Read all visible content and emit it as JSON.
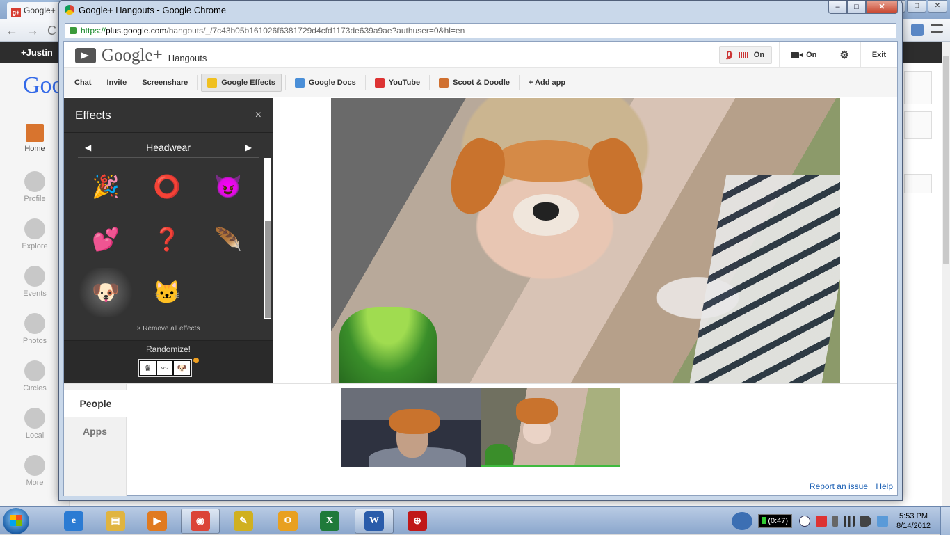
{
  "background_window": {
    "tab_label": "Google+",
    "user_name": "+Justin",
    "logo": "Goo",
    "nav_items": [
      {
        "label": "Home",
        "icon": "home-icon"
      },
      {
        "label": "Profile",
        "icon": "profile-icon"
      },
      {
        "label": "Explore",
        "icon": "compass-icon"
      },
      {
        "label": "Events",
        "icon": "calendar-icon"
      },
      {
        "label": "Photos",
        "icon": "camera-icon"
      },
      {
        "label": "Circles",
        "icon": "circles-icon"
      },
      {
        "label": "Local",
        "icon": "pin-icon"
      },
      {
        "label": "More",
        "icon": "more-icon"
      }
    ]
  },
  "popup": {
    "window_title": "Google+ Hangouts - Google Chrome",
    "url_protocol": "https://",
    "url_host": "plus.google.com",
    "url_path": "/hangouts/_/7c43b05b161026f6381729d4cfd1173de639a9ae?authuser=0&hl=en"
  },
  "hangout": {
    "brand": "Google+",
    "product": "Hangouts",
    "mic_label": "On",
    "camera_label": "On",
    "exit_label": "Exit",
    "toolbar": [
      "Chat",
      "Invite",
      "Screenshare",
      "Google Effects",
      "Google Docs",
      "YouTube",
      "Scoot & Doodle",
      "+ Add app"
    ],
    "toolbar_active": "Google Effects"
  },
  "effects": {
    "title": "Effects",
    "close": "×",
    "category": "Headwear",
    "prev": "◀",
    "next": "▶",
    "items": [
      {
        "name": "party-hat",
        "glyph": "🎉"
      },
      {
        "name": "halo",
        "glyph": "⭕"
      },
      {
        "name": "devil-horns",
        "glyph": "😈"
      },
      {
        "name": "hearts",
        "glyph": "💕"
      },
      {
        "name": "question-mustache",
        "glyph": "❓"
      },
      {
        "name": "feather",
        "glyph": "🪶"
      },
      {
        "name": "dog-ears",
        "glyph": "🐶",
        "selected": true
      },
      {
        "name": "cat-mask",
        "glyph": "🐱"
      }
    ],
    "remove_all": "× Remove all effects",
    "randomize_label": "Randomize!",
    "slot_symbols": [
      "♛",
      "〰",
      "🐶"
    ]
  },
  "bottom": {
    "tabs": [
      "People",
      "Apps"
    ],
    "active_tab": "People",
    "report_link": "Report an issue",
    "help_link": "Help"
  },
  "taskbar": {
    "timer": "(0:47)",
    "time": "5:53 PM",
    "date": "8/14/2012",
    "apps": [
      {
        "name": "internet-explorer",
        "glyph": "e",
        "color": "#2b7bd3"
      },
      {
        "name": "file-explorer",
        "glyph": "▤",
        "color": "#e0b440"
      },
      {
        "name": "media-player",
        "glyph": "▶",
        "color": "#e07a20"
      },
      {
        "name": "chrome",
        "glyph": "◉",
        "color": "#db4437"
      },
      {
        "name": "norton",
        "glyph": "✎",
        "color": "#d0b020"
      },
      {
        "name": "outlook",
        "glyph": "O",
        "color": "#e8a020"
      },
      {
        "name": "excel",
        "glyph": "X",
        "color": "#1f7a3a"
      },
      {
        "name": "word",
        "glyph": "W",
        "color": "#2a5caa"
      },
      {
        "name": "other",
        "glyph": "⊕",
        "color": "#c01818"
      }
    ]
  }
}
